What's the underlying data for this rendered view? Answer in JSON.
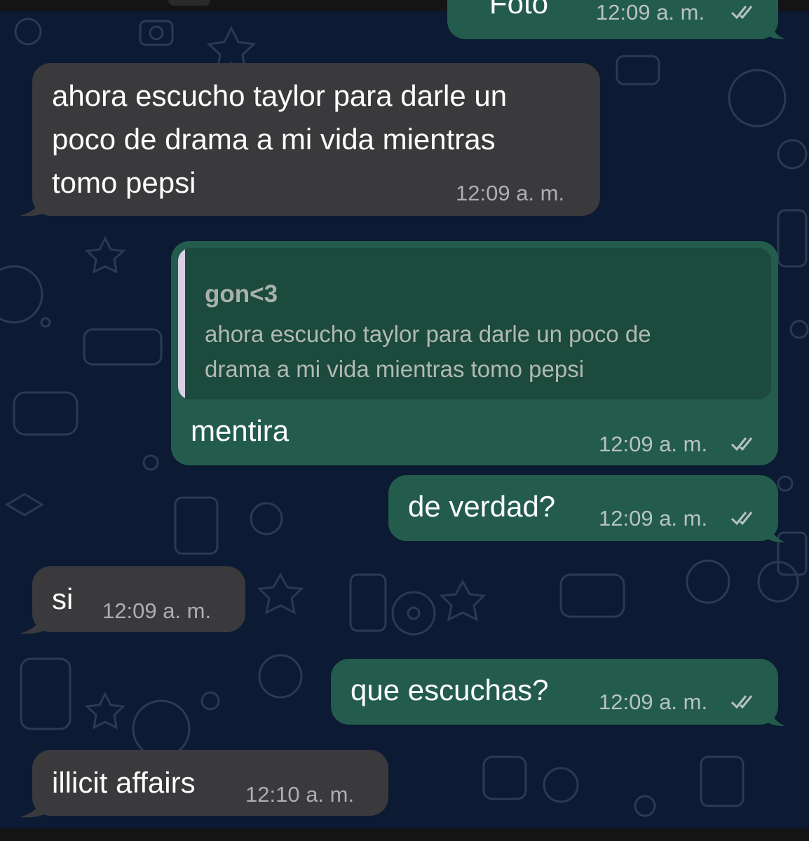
{
  "colors": {
    "background": "#0c1a33",
    "incoming_bubble": "#3a3a3c",
    "outgoing_bubble": "#235c4c",
    "quote_box": "#1c4a3c",
    "quote_bar": "#d9cfe6",
    "read_ticks": "#b8c2be"
  },
  "icons": {
    "read_ticks": "double-check-icon"
  },
  "messages": [
    {
      "direction": "outgoing",
      "text": "Foto",
      "time": "12:09 a. m.",
      "read": true
    },
    {
      "direction": "incoming",
      "lines": [
        "ahora escucho taylor para darle un",
        "poco de drama a mi vida mientras",
        "tomo pepsi"
      ],
      "time": "12:09 a. m."
    },
    {
      "direction": "outgoing",
      "quote": {
        "author": "gon<3",
        "lines": [
          "ahora escucho taylor para darle un poco de",
          "drama a mi vida mientras tomo pepsi"
        ]
      },
      "text": "mentira",
      "time": "12:09 a. m.",
      "read": true
    },
    {
      "direction": "outgoing",
      "text": "de verdad?",
      "time": "12:09 a. m.",
      "read": true
    },
    {
      "direction": "incoming",
      "text": "si",
      "time": "12:09 a. m."
    },
    {
      "direction": "outgoing",
      "text": "que escuchas?",
      "time": "12:09 a. m.",
      "read": true
    },
    {
      "direction": "incoming",
      "text": "illicit affairs",
      "time": "12:10 a. m."
    }
  ]
}
